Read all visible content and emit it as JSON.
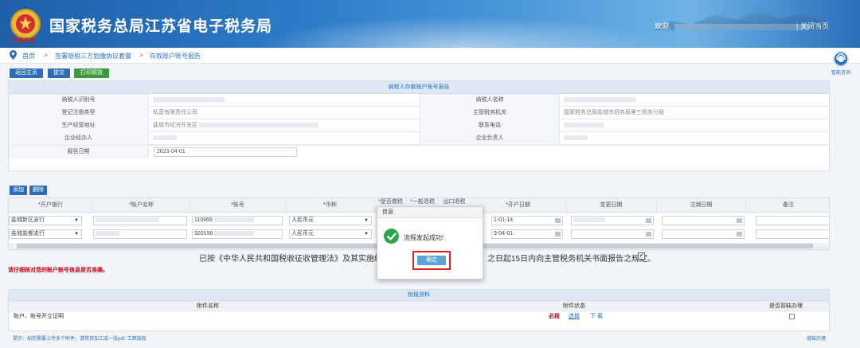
{
  "header": {
    "emblem_text": "中国税务",
    "title": "国家税务总局江苏省电子税务局",
    "welcome": "欢迎,",
    "logout": "| 关闭当页"
  },
  "breadcrumb": {
    "home": "首页",
    "level1": "签署银税三方划缴协议套餐",
    "level2": "存款账户账号报告",
    "sep": ">"
  },
  "help": {
    "label": "智能咨询"
  },
  "actions": {
    "back": "返回主页",
    "submit": "提交",
    "print": "打印预览"
  },
  "report": {
    "heading": "纳税人存款账户账号报告",
    "rows": [
      {
        "l1": "纳税人识别号",
        "v1": "",
        "l2": "纳税人名称",
        "v2": ""
      },
      {
        "l1": "登记注册类型",
        "v1": "私营有限责任公司",
        "l2": "主管税务机关",
        "v2": "国家税务总局盐城市税务局第三税务分局"
      },
      {
        "l1": "生产经营地址",
        "v1": "盐城市经济开发区",
        "l2": "联系电话",
        "v2": ""
      },
      {
        "l1": "企业经办人",
        "v1": "",
        "l2": "企业负责人",
        "v2": ""
      }
    ],
    "date_label": "报告日期",
    "date_value": "2023-04-01"
  },
  "account_actions": {
    "add": "添加",
    "delete": "删除"
  },
  "accounts": {
    "columns": [
      {
        "label": "开户银行",
        "req": "*"
      },
      {
        "label": "账户名称",
        "req": "*"
      },
      {
        "label": "账号",
        "req": "*"
      },
      {
        "label": "币种",
        "req": "*"
      },
      {
        "label": "是否缴税",
        "req": "*"
      },
      {
        "label": "一般退税",
        "req": "*"
      },
      {
        "label": "出口退税",
        "req": ""
      },
      {
        "label": "开户日期",
        "req": "*"
      },
      {
        "label": "变更日期",
        "req": ""
      },
      {
        "label": "注销日期",
        "req": ""
      },
      {
        "label": "备注",
        "req": ""
      }
    ],
    "rows": [
      {
        "bank": "盐城新区支行",
        "account_no": "110966",
        "currency": "人民币元",
        "open_date": "1-01-14"
      },
      {
        "bank": "盐城盐都支行",
        "account_no": "320156",
        "currency": "人民币元",
        "open_date": "3-04-01"
      }
    ]
  },
  "notice": {
    "left": "已按《中华人民共和国税收征收管理法》及其实施细则规",
    "right": "之日起15日内向主管税务机关书面报告之规定。",
    "checked": "✔"
  },
  "warning": "请仔细核对您的账户账号信息是否准确。",
  "attachments": {
    "heading": "附报资料",
    "col_name": "附件名称",
    "col_status": "附件状态",
    "col_tolerate": "是否容缺办理",
    "row_name": "账户、账号开立证明",
    "required": "必报",
    "choose": "选择",
    "download": "下 载"
  },
  "footnote": "提示：如您需要上传多个附件，请将其加工成一张pdf: 工具链接",
  "footlink": "容缺办理",
  "modal": {
    "title": "信息",
    "message": "流程发起成功!",
    "ok": "确定"
  }
}
